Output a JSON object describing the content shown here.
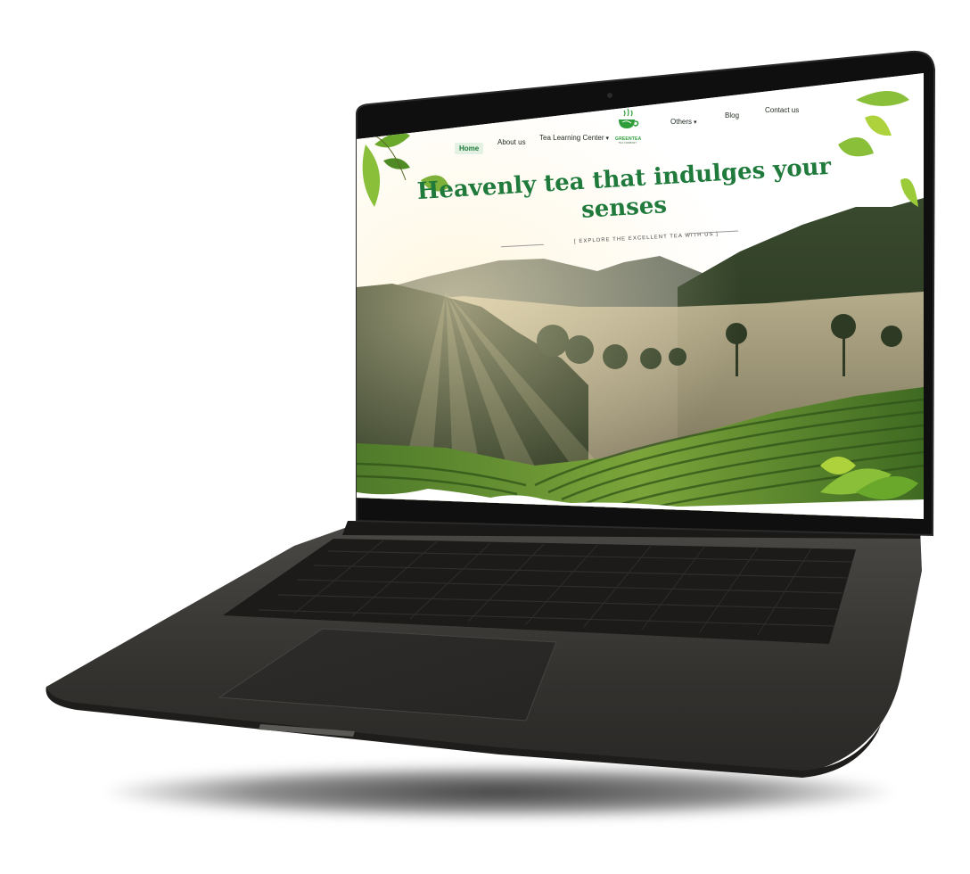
{
  "brand": {
    "name": "GREENTEA",
    "tagline": "TEA COMPANY"
  },
  "nav": {
    "home": "Home",
    "about": "About us",
    "learning": "Tea Learning Center",
    "others": "Others",
    "blog": "Blog",
    "contact": "Contact us"
  },
  "hero": {
    "title_line1": "Heavenly tea that indulges your",
    "title_line2": "senses",
    "subtitle": "[ EXPLORE THE EXCELLENT TEA WITH US ]"
  },
  "colors": {
    "accent_green": "#1f7a3b",
    "home_highlight": "#e3f1e3",
    "laptop_body": "#3a3836",
    "bezel": "#111111"
  },
  "icons": {
    "dropdown": "chevron-down-icon",
    "logo": "tea-cup-logo-icon",
    "leaf": "tea-leaf-icon"
  }
}
